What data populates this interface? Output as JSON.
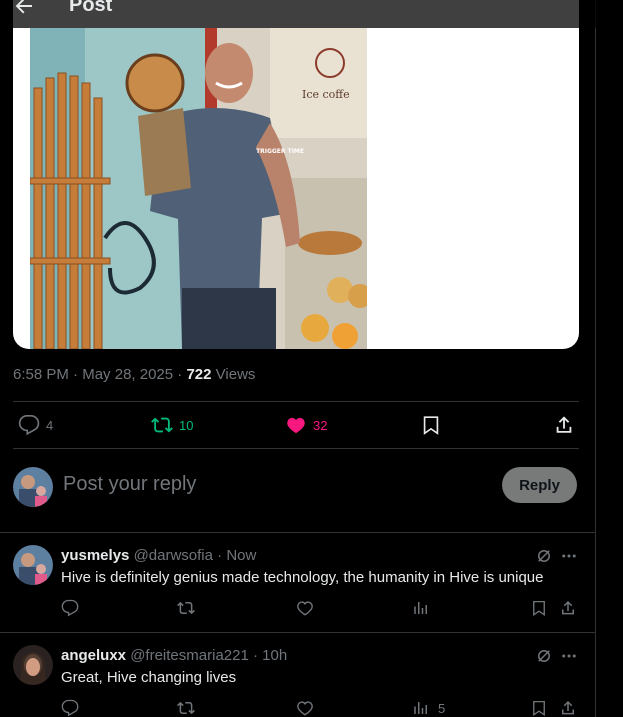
{
  "header": {
    "title": "Post",
    "back_icon": "arrow-left-icon"
  },
  "post": {
    "time": "6:58 PM",
    "date": "May 28, 2025",
    "views_count": "722",
    "views_label": "Views",
    "stats": {
      "replies": "4",
      "reposts": "10",
      "likes": "32"
    },
    "photo_text": {
      "shirt": "TRIGGER TIME",
      "sign": "Ice coffe"
    }
  },
  "composer": {
    "placeholder": "Post your reply",
    "button_label": "Reply"
  },
  "comments": [
    {
      "name": "yusmelys",
      "handle": "@darwsofia",
      "time": "Now",
      "text": "Hive is definitely genius made technology, the humanity in Hive is unique",
      "views": ""
    },
    {
      "name": "angeluxx",
      "handle": "@freitesmaria221",
      "time": "10h",
      "text": "Great, Hive changing lives",
      "views": "5"
    }
  ],
  "colors": {
    "background": "#000000",
    "text": "#e7e9ea",
    "muted": "#71767b",
    "repost": "#00ba7c",
    "like": "#f91880",
    "reply_button": "#787a7a"
  }
}
